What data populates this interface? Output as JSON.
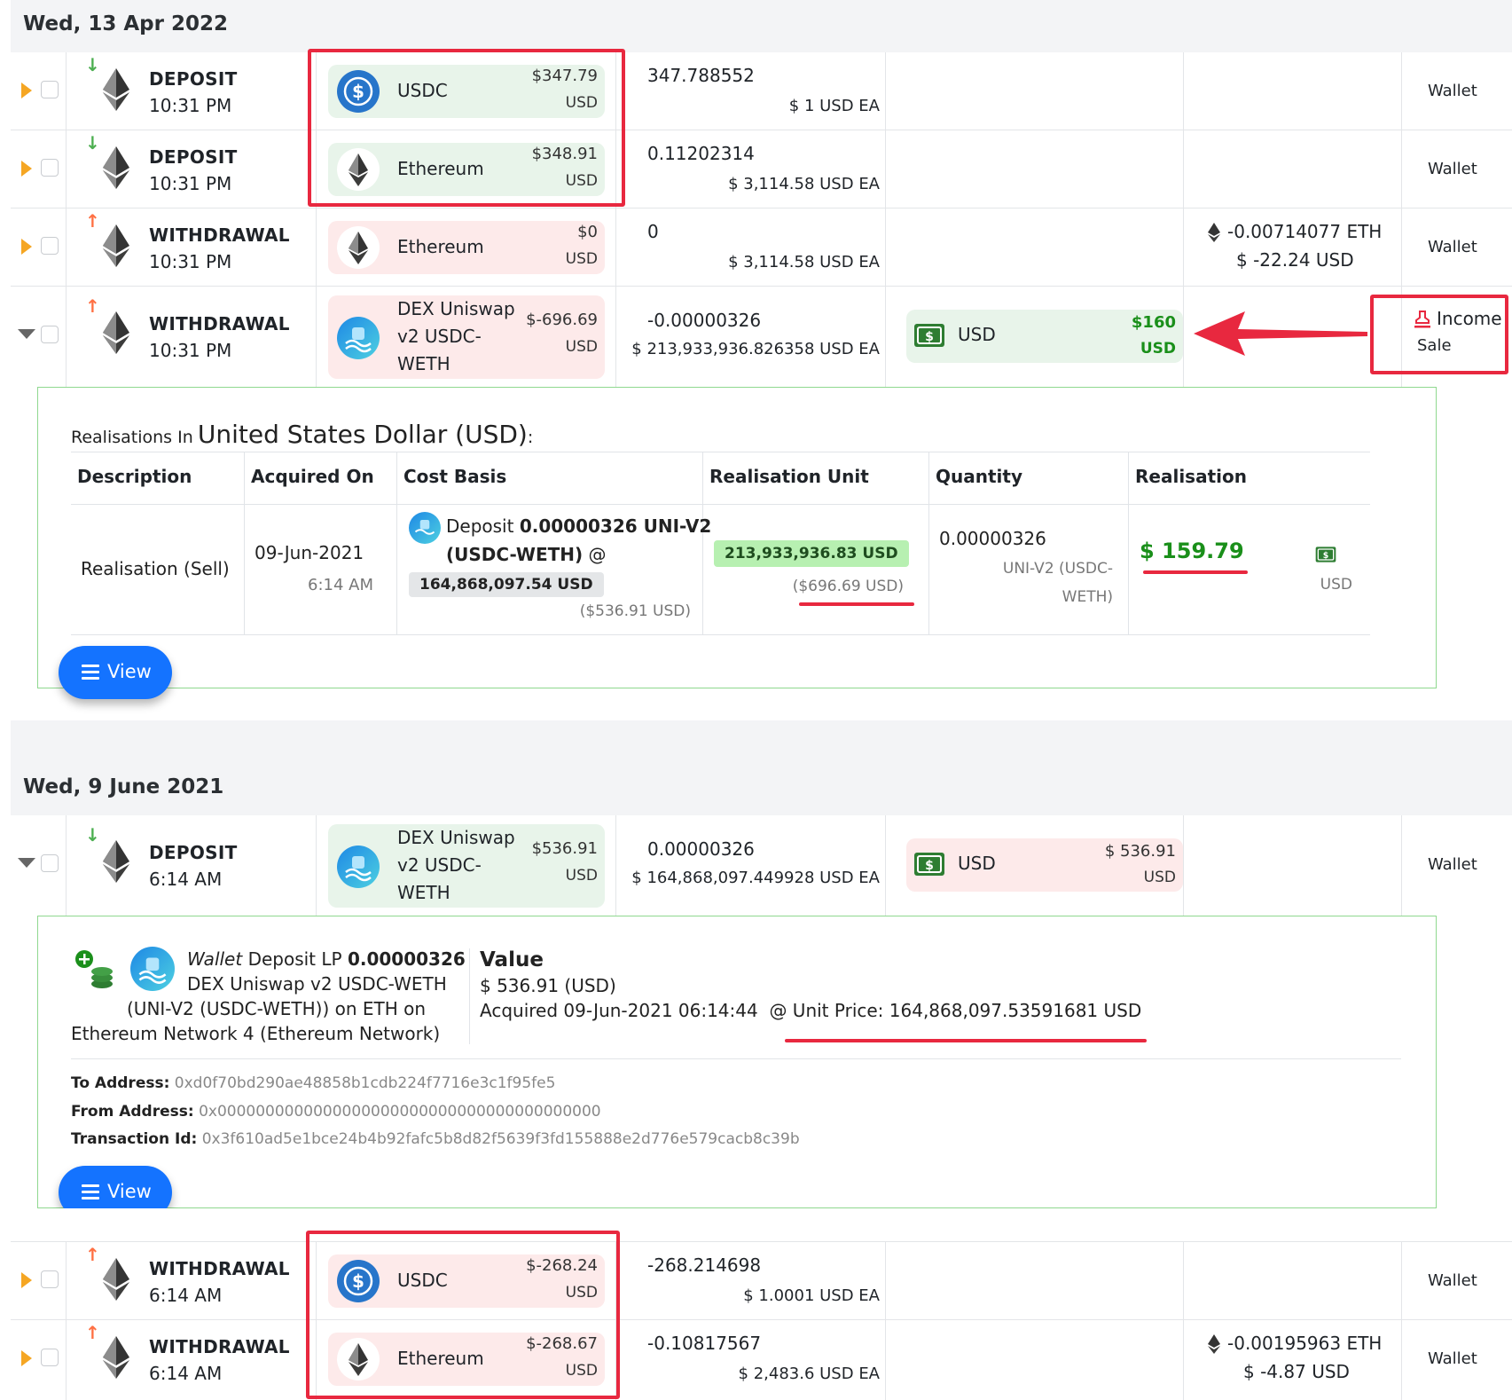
{
  "groups": [
    {
      "date": "Wed, 13 Apr 2022"
    },
    {
      "date": "Wed, 9 June 2021"
    }
  ],
  "rows": [
    {
      "type": "DEPOSIT",
      "time": "10:31 PM",
      "asset": "USDC",
      "asset_value": "$347.79",
      "asset_unit": "USD",
      "qty": "347.788552",
      "ea": "$ 1 USD EA",
      "account": "Wallet"
    },
    {
      "type": "DEPOSIT",
      "time": "10:31 PM",
      "asset": "Ethereum",
      "asset_value": "$348.91",
      "asset_unit": "USD",
      "qty": "0.11202314",
      "ea": "$ 3,114.58 USD EA",
      "account": "Wallet"
    },
    {
      "type": "WITHDRAWAL",
      "time": "10:31 PM",
      "asset": "Ethereum",
      "asset_value": "$0",
      "asset_unit": "USD",
      "qty": "0",
      "ea": "$ 3,114.58 USD EA",
      "fee_eth": "-0.00714077 ETH",
      "fee_usd": "$ -22.24 USD",
      "account": "Wallet"
    },
    {
      "type": "WITHDRAWAL",
      "time": "10:31 PM",
      "asset_line1": "DEX Uniswap",
      "asset_line2": "v2 USDC-",
      "asset_line3": "WETH",
      "asset_value": "$-696.69",
      "asset_unit": "USD",
      "qty": "-0.00000326",
      "ea": "$ 213,933,936.826358 USD EA",
      "counter_asset": "USD",
      "counter_value": "$160",
      "counter_unit": "USD",
      "category": "Income",
      "subcategory": "Sale"
    },
    {
      "type": "DEPOSIT",
      "time": "6:14 AM",
      "asset_line1": "DEX Uniswap",
      "asset_line2": "v2 USDC-",
      "asset_line3": "WETH",
      "asset_value": "$536.91",
      "asset_unit": "USD",
      "qty": "0.00000326",
      "ea": "$ 164,868,097.449928 USD EA",
      "counter_asset": "USD",
      "counter_value": "$ 536.91",
      "counter_unit": "USD",
      "account": "Wallet"
    },
    {
      "type": "WITHDRAWAL",
      "time": "6:14 AM",
      "asset": "USDC",
      "asset_value": "$-268.24",
      "asset_unit": "USD",
      "qty": "-268.214698",
      "ea": "$ 1.0001 USD EA",
      "account": "Wallet"
    },
    {
      "type": "WITHDRAWAL",
      "time": "6:14 AM",
      "asset": "Ethereum",
      "asset_value": "$-268.67",
      "asset_unit": "USD",
      "qty": "-0.10817567",
      "ea": "$ 2,483.6 USD EA",
      "fee_eth": "-0.00195963 ETH",
      "fee_usd": "$ -4.87 USD",
      "account": "Wallet"
    }
  ],
  "realisation": {
    "prefix": "Realisations In",
    "currency": "United States Dollar (USD)",
    "suffix": ":",
    "headers": [
      "Description",
      "Acquired On",
      "Cost Basis",
      "Realisation Unit",
      "Quantity",
      "Realisation"
    ],
    "description": "Realisation (Sell)",
    "acquired_date": "09-Jun-2021",
    "acquired_time": "6:14 AM",
    "cost_prefix": "Deposit",
    "cost_amount": "0.00000326 UNI-V2",
    "cost_pair": "(USDC-WETH)",
    "cost_at": "@",
    "cost_unit_price": "164,868,097.54 USD",
    "cost_total": "($536.91 USD)",
    "unit_price": "213,933,936.83 USD",
    "unit_total": "($696.69 USD)",
    "quantity": "0.00000326",
    "quantity_unit1": "UNI-V2 (USDC-",
    "quantity_unit2": "WETH)",
    "realisation_value": "$ 159.79",
    "realisation_unit": "USD"
  },
  "deposit_detail": {
    "wallet_word": "Wallet",
    "deposit_word": "Deposit LP",
    "amount": "0.00000326",
    "line2": "DEX Uniswap v2 USDC-WETH",
    "line3": "(UNI-V2 (USDC-WETH)) on ETH on",
    "line4": "Ethereum Network 4 (Ethereum Network)",
    "value_heading": "Value",
    "value_amount": "$ 536.91 (USD)",
    "acquired": "Acquired 09-Jun-2021 06:14:44",
    "unit_price": "@ Unit Price: 164,868,097.53591681 USD",
    "to_label": "To Address:",
    "to_value": "0xd0f70bd290ae48858b1cdb224f7716e3c1f95fe5",
    "from_label": "From Address:",
    "from_value": "0x0000000000000000000000000000000000000000",
    "tx_label": "Transaction Id:",
    "tx_value": "0x3f610ad5e1bce24b4b92fafc5b8d82f5639f3fd155888e2d776e579cacb8c39b"
  },
  "view_label": "View",
  "colors": {
    "accent": "#1473ff",
    "highlight": "#e8283f",
    "positive": "#1a8f1a",
    "deposit_bg": "#e8f4ea",
    "withdraw_bg": "#fdeaea"
  }
}
